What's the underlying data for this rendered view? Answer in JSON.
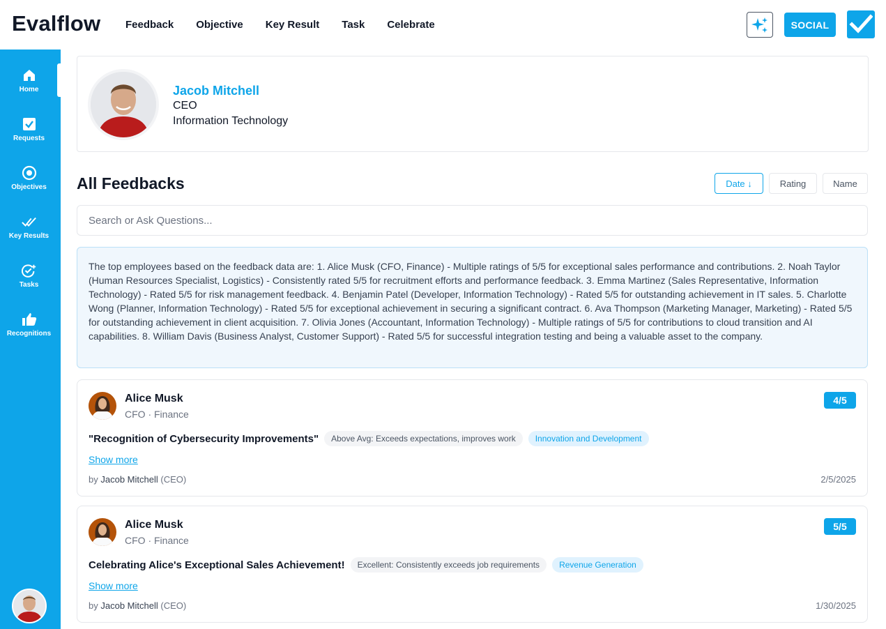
{
  "app": {
    "logo": "Evalflow",
    "nav": [
      "Feedback",
      "Objective",
      "Key Result",
      "Task",
      "Celebrate"
    ],
    "social_label": "SOCIAL",
    "ai_icon": "sparkles-icon",
    "check_icon": "checkbox-icon",
    "accent_color": "#0ea5e9"
  },
  "sidebar": {
    "items": [
      {
        "label": "Home",
        "icon": "home-icon"
      },
      {
        "label": "Requests",
        "icon": "check-square-icon"
      },
      {
        "label": "Objectives",
        "icon": "target-icon"
      },
      {
        "label": "Key Results",
        "icon": "double-check-icon"
      },
      {
        "label": "Tasks",
        "icon": "check-plus-icon"
      },
      {
        "label": "Recognitions",
        "icon": "thumbs-up-icon"
      }
    ],
    "active": "Home"
  },
  "profile": {
    "name": "Jacob Mitchell",
    "title": "CEO",
    "department": "Information Technology"
  },
  "feedbacks": {
    "title": "All Feedbacks",
    "sort": {
      "date": "Date ↓",
      "rating": "Rating",
      "name": "Name",
      "active": "date"
    },
    "search_placeholder": "Search or Ask Questions...",
    "summary": "The top employees based on the feedback data are: 1. Alice Musk (CFO, Finance) - Multiple ratings of 5/5 for exceptional sales performance and contributions. 2. Noah Taylor (Human Resources Specialist, Logistics) - Consistently rated 5/5 for recruitment efforts and performance feedback. 3. Emma Martinez (Sales Representative, Information Technology) - Rated 5/5 for risk management feedback. 4. Benjamin Patel (Developer, Information Technology) - Rated 5/5 for outstanding achievement in IT sales. 5. Charlotte Wong (Planner, Information Technology) - Rated 5/5 for exceptional achievement in securing a significant contract. 6. Ava Thompson (Marketing Manager, Marketing) - Rated 5/5 for outstanding achievement in client acquisition. 7. Olivia Jones (Accountant, Information Technology) - Multiple ratings of 5/5 for contributions to cloud transition and AI capabilities. 8. William Davis (Business Analyst, Customer Support) - Rated 5/5 for successful integration testing and being a valuable asset to the company.",
    "items": [
      {
        "name": "Alice Musk",
        "role": "CFO · Finance",
        "rating": "4/5",
        "headline": "\"Recognition of Cybersecurity Improvements\"",
        "level_tag": "Above Avg: Exceeds expectations, improves work",
        "category_tag": "Innovation and Development",
        "show_more": "Show more",
        "by_prefix": "by",
        "author": "Jacob Mitchell",
        "author_role": "(CEO)",
        "date": "2/5/2025"
      },
      {
        "name": "Alice Musk",
        "role": "CFO · Finance",
        "rating": "5/5",
        "headline": "Celebrating Alice's Exceptional Sales Achievement!",
        "level_tag": "Excellent: Consistently exceeds job requirements",
        "category_tag": "Revenue Generation",
        "show_more": "Show more",
        "by_prefix": "by",
        "author": "Jacob Mitchell",
        "author_role": "(CEO)",
        "date": "1/30/2025"
      }
    ]
  }
}
